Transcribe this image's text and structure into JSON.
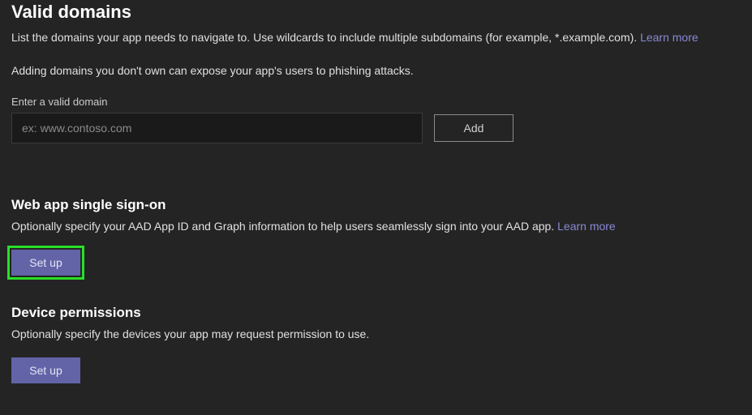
{
  "validDomains": {
    "title": "Valid domains",
    "description": "List the domains your app needs to navigate to. Use wildcards to include multiple subdomains (for example, *.example.com). ",
    "learnMore": "Learn more",
    "warning": "Adding domains you don't own can expose your app's users to phishing attacks.",
    "fieldLabel": "Enter a valid domain",
    "placeholder": "ex: www.contoso.com",
    "addButton": "Add"
  },
  "sso": {
    "title": "Web app single sign-on",
    "description": "Optionally specify your AAD App ID and Graph information to help users seamlessly sign into your AAD app. ",
    "learnMore": "Learn more",
    "setupButton": "Set up"
  },
  "devicePermissions": {
    "title": "Device permissions",
    "description": "Optionally specify the devices your app may request permission to use.",
    "setupButton": "Set up"
  }
}
